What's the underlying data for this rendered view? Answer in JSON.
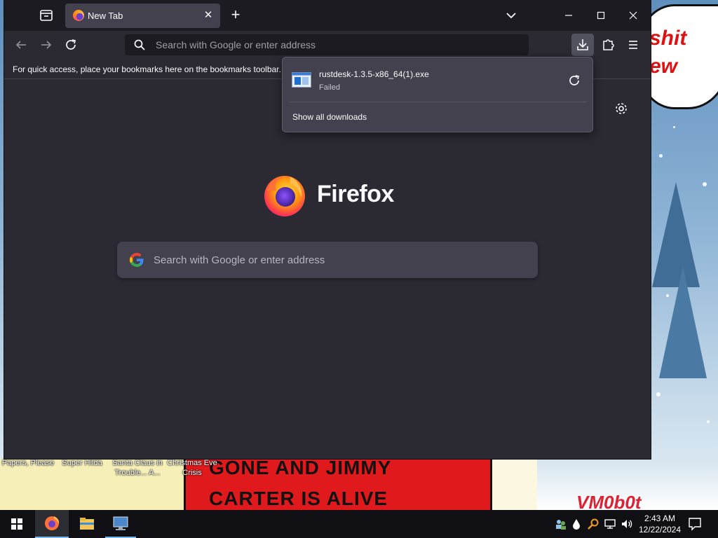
{
  "desktop": {
    "bubble_lines": [
      "shit",
      "ew"
    ],
    "comic_lines": [
      "GONE AND JIMMY",
      "CARTER IS ALIVE"
    ],
    "signature": "VM0b0t",
    "icons": [
      {
        "label": "Papers, Please"
      },
      {
        "label": "Super Hilda"
      },
      {
        "label": "Santa Claus in Trouble... A..."
      },
      {
        "label": "Christmas Eve Crisis"
      }
    ]
  },
  "browser": {
    "tab": {
      "title": "New Tab",
      "icon": "firefox-icon"
    },
    "urlbar": {
      "placeholder": "Search with Google or enter address"
    },
    "bookmarks_bar": {
      "text": "For quick access, place your bookmarks here on the bookmarks toolbar. M"
    },
    "content": {
      "brand": "Firefox",
      "search_placeholder": "Search with Google or enter address"
    },
    "downloads_panel": {
      "items": [
        {
          "filename": "rustdesk-1.3.5-x86_64(1).exe",
          "status": "Failed",
          "icon": "installer-file-icon"
        }
      ],
      "show_all": "Show all downloads"
    }
  },
  "taskbar": {
    "pinned": [
      "start-icon",
      "firefox-icon",
      "file-explorer-icon",
      "remote-desktop-icon"
    ],
    "tray": [
      "network-people-icon",
      "water-drop-icon",
      "search-key-icon",
      "network-icon",
      "volume-icon"
    ],
    "clock": {
      "time": "2:43 AM",
      "date": "12/22/2024"
    }
  },
  "colors": {
    "window_bg": "#2b2a33",
    "titlebar_bg": "#1c1b22",
    "panel_bg": "#42414d",
    "text": "#fbfbfe",
    "accent": "#76b9ed"
  }
}
